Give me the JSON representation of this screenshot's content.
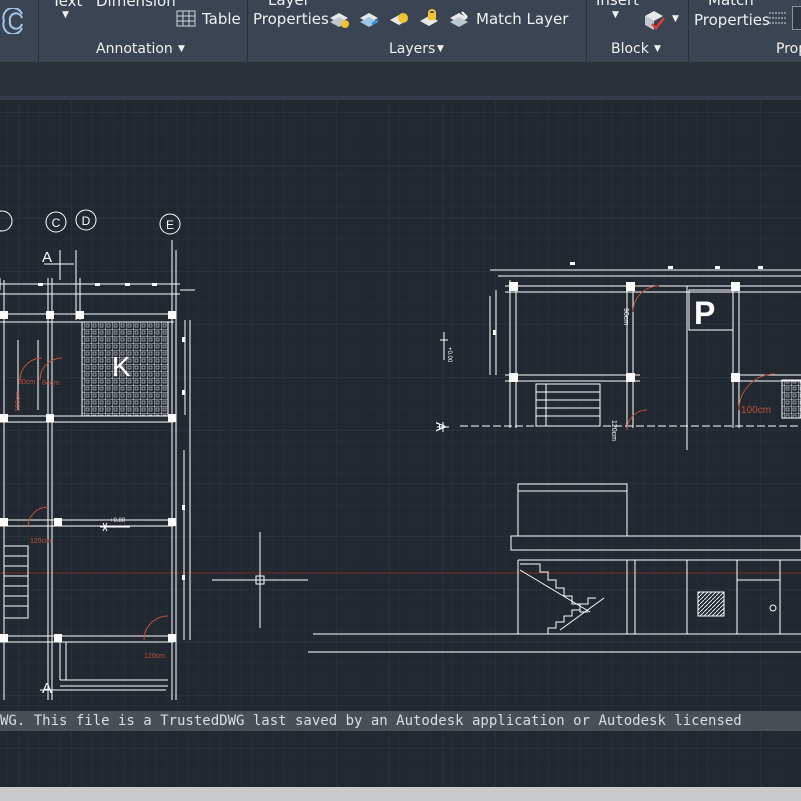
{
  "ribbon": {
    "text_label": "Text",
    "dimension_label": "Dimension",
    "table_label": "Table",
    "annotation_panel": "Annotation",
    "layer_label_line1": "Layer",
    "layer_label_line2": "Properties",
    "match_layer_label": "Match Layer",
    "layers_panel": "Layers",
    "insert_label": "Insert",
    "block_panel": "Block",
    "match_label_line1": "Match",
    "match_label_line2": "Properties",
    "properties_panel": "Prop"
  },
  "drawing": {
    "grid_bubbles": [
      "C",
      "D",
      "E"
    ],
    "section_label": "A",
    "room_label_k": "K",
    "room_label_p": "P",
    "dim_80cm": "80cm",
    "dim_84cm": "84cm",
    "dim_100cm_left": "100cm",
    "dim_120cm_a": "120cm",
    "dim_120cm_b": "120cm",
    "dim_100cm_right": "100cm",
    "dim_90cm": "90cm",
    "dim_120cm_v": "120cm",
    "level_080": "+0.80",
    "level_000": "+0.00"
  },
  "command_line": {
    "text": "WG.  This file is a TrustedDWG last saved by an Autodesk application or Autodesk licensed"
  },
  "colors": {
    "canvas_bg": "#212830",
    "ribbon_bg": "#3b4453",
    "line_white": "#ffffff",
    "dim_red": "#c0503a"
  }
}
